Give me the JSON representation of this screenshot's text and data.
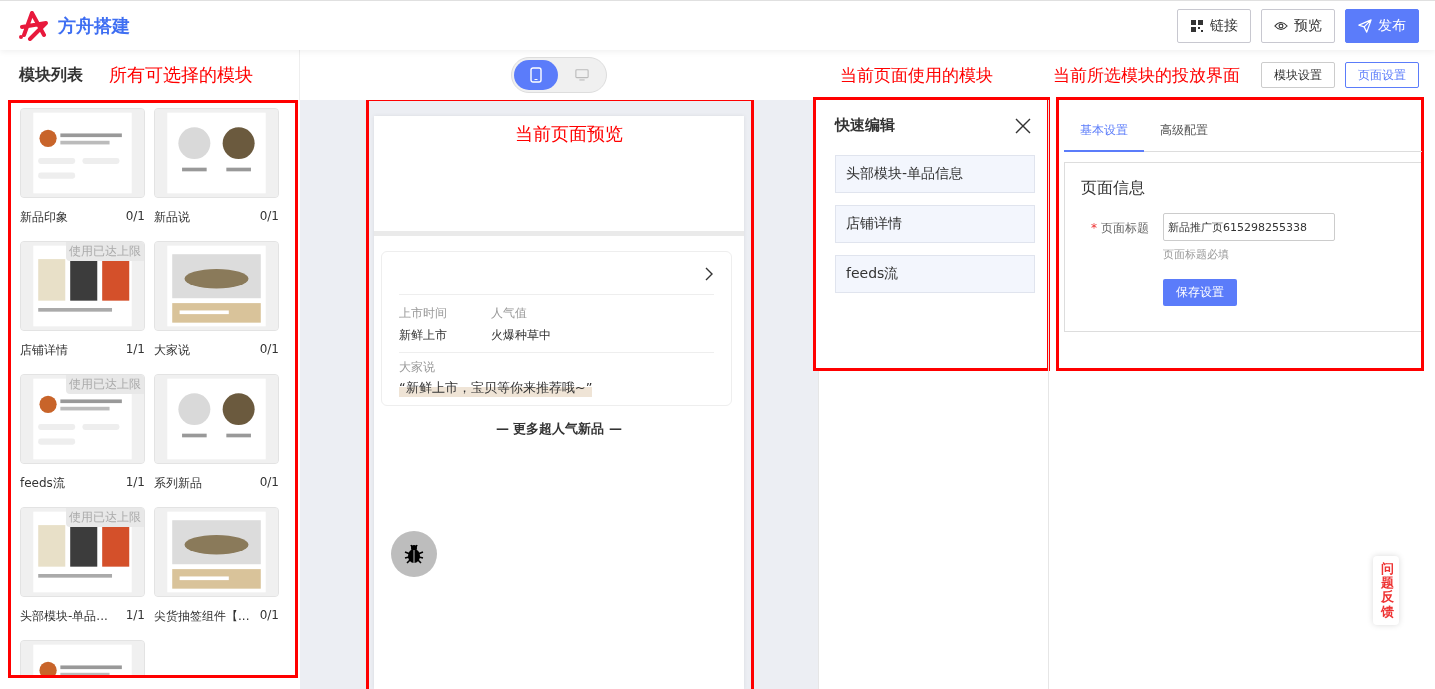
{
  "header": {
    "brand": "方舟搭建",
    "buttons": [
      {
        "label": "链接",
        "kind": "qr",
        "primary": false
      },
      {
        "label": "预览",
        "kind": "eye",
        "primary": false
      },
      {
        "label": "发布",
        "kind": "send",
        "primary": true
      }
    ]
  },
  "module_list": {
    "title": "模块列表",
    "annotation": "所有可选择的模块",
    "modules": [
      {
        "name": "新品印象",
        "count": "0/1",
        "kind": "picture"
      },
      {
        "name": "新品说",
        "count": "0/1",
        "kind": "picture"
      },
      {
        "name": "店铺详情",
        "count": "1/1",
        "badge": "使用已达上限",
        "kind": "picture"
      },
      {
        "name": "大家说",
        "count": "0/1",
        "kind": "picture"
      },
      {
        "name": "feeds流",
        "count": "1/1",
        "badge": "使用已达上限",
        "kind": "picture"
      },
      {
        "name": "系列新品",
        "count": "0/1",
        "kind": "picture"
      },
      {
        "name": "头部模块-单品...",
        "count": "1/1",
        "badge": "使用已达上限",
        "kind": "picture"
      },
      {
        "name": "尖货抽签组件【...",
        "count": "0/1",
        "kind": "picture"
      },
      {
        "kind": "picture"
      }
    ]
  },
  "device_toggle": [
    {
      "kind": "phone",
      "selected": true
    },
    {
      "kind": "desktop",
      "selected": false
    }
  ],
  "preview": {
    "annotation": "当前页面预览",
    "info": [
      {
        "label": "上市时间",
        "value": "新鲜上市"
      },
      {
        "label": "人气值",
        "value": "火爆种草中"
      }
    ],
    "quote_label": "大家说",
    "quote": "“新鲜上市，宝贝等你来推荐哦~”",
    "more": "— 更多超人气新品 —"
  },
  "quick_edit": {
    "annotation": "当前页面使用的模块",
    "title": "快速编辑",
    "items": [
      "头部模块-单品信息",
      "店铺详情",
      "feeds流"
    ]
  },
  "settings": {
    "annotation": "当前所选模块的投放界面",
    "mode_buttons": [
      {
        "label": "模块设置",
        "selected": false
      },
      {
        "label": "页面设置",
        "selected": true
      }
    ],
    "tabs": [
      {
        "label": "基本设置",
        "selected": true
      },
      {
        "label": "高级配置",
        "selected": false
      }
    ],
    "section_title": "页面信息",
    "field": {
      "label": "页面标题",
      "required_mark": "*",
      "value": "新品推广页615298255338",
      "hint": "页面标题必填"
    },
    "save": "保存设置"
  },
  "feedback": "问题反馈"
}
